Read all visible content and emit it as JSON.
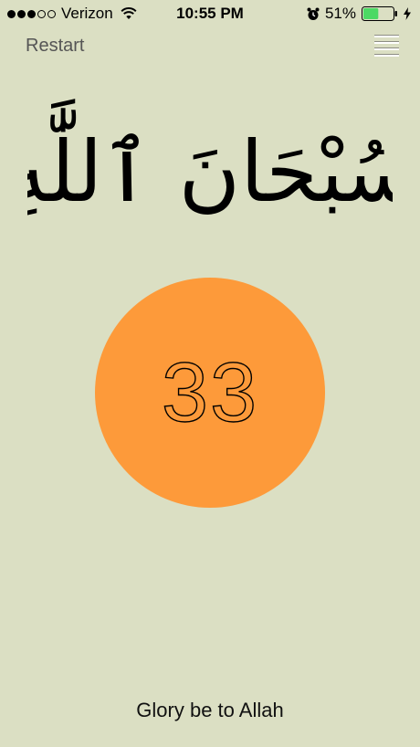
{
  "status_bar": {
    "carrier": "Verizon",
    "signal_bars_filled": 3,
    "signal_bars_total": 5,
    "time": "10:55 PM",
    "battery_percent": "51%",
    "battery_level": 0.51,
    "icons": [
      "wifi-icon",
      "alarm-icon",
      "battery-icon",
      "charging-bolt-icon"
    ]
  },
  "nav": {
    "restart_label": "Restart",
    "menu_icon": "hamburger-menu-icon"
  },
  "phrase": {
    "arabic": "سُبْحَانَ ٱللَّٰهِ",
    "translation": "Glory be to Allah"
  },
  "counter": {
    "value": "33"
  },
  "colors": {
    "background": "#dbdfc3",
    "counter_circle": "#fd9a3a",
    "battery_fill": "#4cd964"
  }
}
